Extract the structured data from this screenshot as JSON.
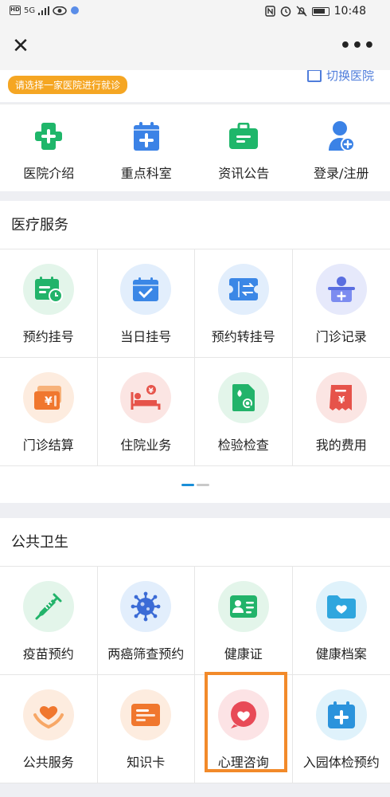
{
  "status_bar": {
    "left_badge": "HD",
    "network": "5G",
    "time": "10:48"
  },
  "nav": {
    "close_glyph": "✕",
    "more_glyph": "•••"
  },
  "hospital": {
    "hint": "请选择一家医院进行就诊",
    "switch_label": "切换医院"
  },
  "quick_nav": [
    {
      "label": "医院介绍",
      "icon": "hospital-cross-icon"
    },
    {
      "label": "重点科室",
      "icon": "calendar-plus-icon"
    },
    {
      "label": "资讯公告",
      "icon": "briefcase-icon"
    },
    {
      "label": "登录/注册",
      "icon": "user-plus-icon"
    }
  ],
  "medical": {
    "title": "医疗服务",
    "items": [
      {
        "label": "预约挂号",
        "icon": "appointment-icon"
      },
      {
        "label": "当日挂号",
        "icon": "same-day-icon"
      },
      {
        "label": "预约转挂号",
        "icon": "transfer-icon"
      },
      {
        "label": "门诊记录",
        "icon": "record-icon"
      },
      {
        "label": "门诊结算",
        "icon": "settlement-icon"
      },
      {
        "label": "住院业务",
        "icon": "inpatient-icon"
      },
      {
        "label": "检验检查",
        "icon": "lab-test-icon"
      },
      {
        "label": "我的费用",
        "icon": "expense-icon"
      }
    ]
  },
  "public": {
    "title": "公共卫生",
    "items": [
      {
        "label": "疫苗预约",
        "icon": "vaccine-icon"
      },
      {
        "label": "两癌筛查预约",
        "icon": "virus-icon"
      },
      {
        "label": "健康证",
        "icon": "health-card-icon"
      },
      {
        "label": "健康档案",
        "icon": "folder-heart-icon"
      },
      {
        "label": "公共服务",
        "icon": "hands-heart-icon"
      },
      {
        "label": "知识卡",
        "icon": "knowledge-card-icon"
      },
      {
        "label": "心理咨询",
        "icon": "heart-chat-icon"
      },
      {
        "label": "入园体检预约",
        "icon": "checkup-icon"
      }
    ]
  },
  "colors": {
    "accent_blue": "#1a8ed8",
    "hint_orange": "#f5a623",
    "highlight_orange": "#f28a2a"
  }
}
